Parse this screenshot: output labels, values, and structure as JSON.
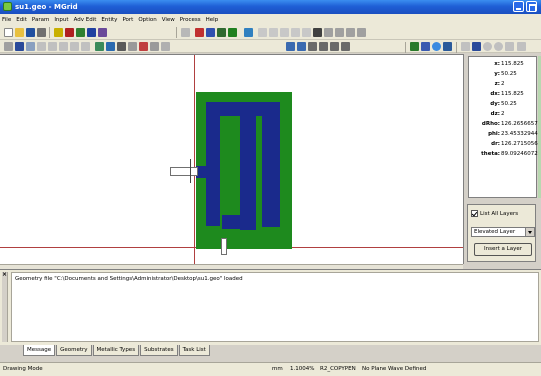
{
  "window": {
    "title": "su1.geo - MGrid"
  },
  "menu": [
    "File",
    "Edit",
    "Param",
    "Input",
    "Adv Edit",
    "Entity",
    "Port",
    "Option",
    "View",
    "Process",
    "Help"
  ],
  "coords": {
    "rows": [
      {
        "k": "x:",
        "v": "115.825"
      },
      {
        "k": "y:",
        "v": "50.25"
      },
      {
        "k": "z:",
        "v": "2"
      },
      {
        "k": "dx:",
        "v": "115.825"
      },
      {
        "k": "dy:",
        "v": "50.25"
      },
      {
        "k": "dz:",
        "v": "2"
      },
      {
        "k": "dRho:",
        "v": "126.2656657"
      },
      {
        "k": "phi:",
        "v": "23.45332944"
      },
      {
        "k": "dr:",
        "v": "126.2715056"
      },
      {
        "k": "theta:",
        "v": "89.09246072"
      }
    ]
  },
  "layers": {
    "list_all_label": "List All Layers",
    "selected_layer": "Elevated Layer",
    "insert_label": "Insert a Layer"
  },
  "log": {
    "message": "Geometry file \"C:\\Documents and Settings\\Administrator\\Desktop\\su1.geo\" loaded"
  },
  "tabs": [
    "Message",
    "Geometry",
    "Metallic Types",
    "Substrates",
    "Task List"
  ],
  "status": {
    "mode": "Drawing Mode",
    "units": "mm",
    "zoom": "1.1004%",
    "copy": "R2_COPYPEN",
    "wave": "No Plane Wave Defined"
  },
  "colors": {
    "substrate": "#1e8a1e",
    "metal": "#1a2a8c",
    "titlebar": "#1f5fd6"
  }
}
